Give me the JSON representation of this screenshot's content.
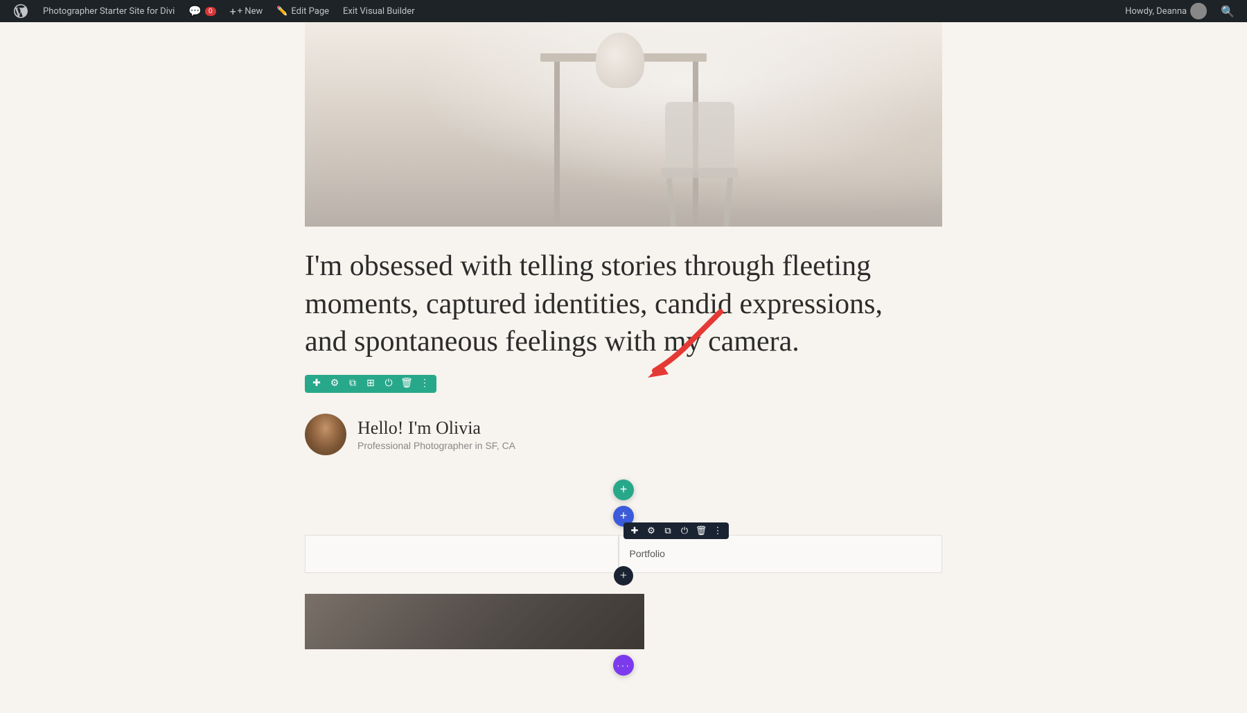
{
  "admin_bar": {
    "site_name": "Photographer Starter Site for Divi",
    "new_label": "+ New",
    "edit_page_label": "Edit Page",
    "exit_vb_label": "Exit Visual Builder",
    "comment_count": "0",
    "howdy_text": "Howdy, Deanna"
  },
  "toolbar_green": {
    "icons": [
      "plus",
      "gear",
      "copy",
      "columns",
      "power",
      "trash",
      "dots"
    ]
  },
  "toolbar_dark": {
    "icons": [
      "plus",
      "gear",
      "copy",
      "power",
      "trash",
      "dots"
    ]
  },
  "hero": {
    "quote": "I'm obsessed with telling stories through fleeting moments, captured identities, candid expressions, and spontaneous feelings with my camera.",
    "author_name": "Hello! I'm Olivia",
    "author_title": "Professional Photographer in SF, CA"
  },
  "add_buttons": {
    "teal_plus": "+",
    "blue_plus": "+",
    "purple_dots": "···"
  },
  "portfolio_text": "Portfolio",
  "section_add_labels": {
    "add_section": "+",
    "add_row": "+"
  }
}
